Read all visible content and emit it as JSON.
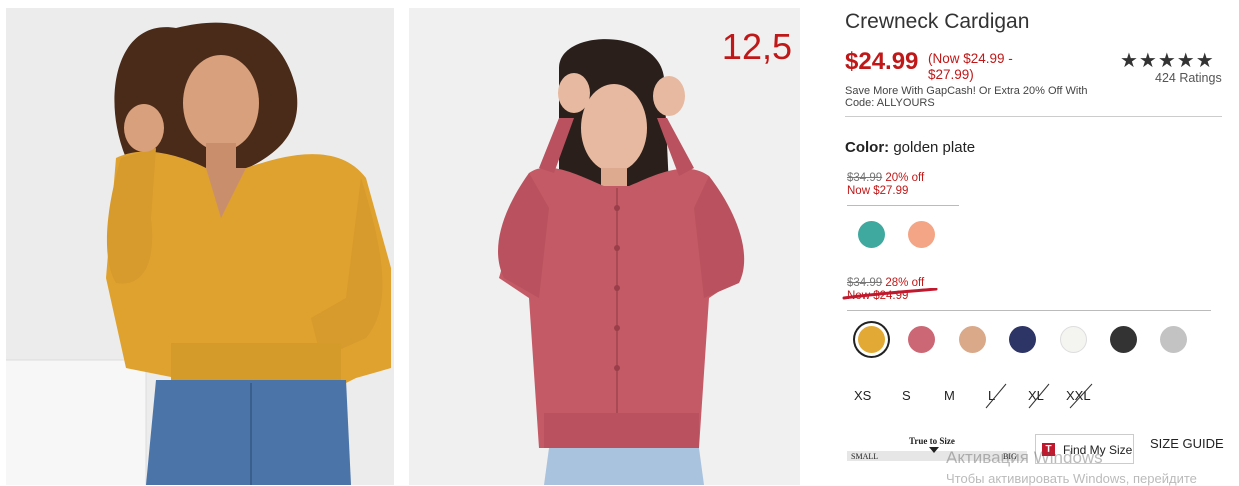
{
  "product": {
    "title": "Crewneck Cardigan",
    "price": "$24.99",
    "price_range": "(Now $24.99 - $27.99)",
    "rating_stars": "★★★★★",
    "rating_value": 4.5,
    "ratings_count": "424 Ratings",
    "promo": "Save More With GapCash! Or Extra 20% Off With Code: ALLYOURS"
  },
  "images": {
    "overlay_price": "12,5"
  },
  "color": {
    "label": "Color:",
    "value": "golden plate"
  },
  "tiers": [
    {
      "was": "$34.99",
      "off": "20% off",
      "now": "Now $27.99"
    },
    {
      "was": "$34.99",
      "off": "28% off",
      "now": "Now $24.99"
    }
  ],
  "swatches_tier1": [
    {
      "name": "teal",
      "color": "#3fa9a0"
    },
    {
      "name": "peach",
      "color": "#f4a585"
    }
  ],
  "swatches_tier2": [
    {
      "name": "golden plate",
      "color": "#e2a934",
      "selected": true
    },
    {
      "name": "rose",
      "color": "#cc6875"
    },
    {
      "name": "tan",
      "color": "#d9a98a"
    },
    {
      "name": "navy",
      "color": "#2d3466"
    },
    {
      "name": "white",
      "color": "#f4f4f0"
    },
    {
      "name": "black",
      "color": "#333333"
    },
    {
      "name": "grey",
      "color": "#c3c3c3"
    }
  ],
  "sizes": [
    {
      "label": "XS",
      "available": true
    },
    {
      "label": "S",
      "available": true
    },
    {
      "label": "M",
      "available": true
    },
    {
      "label": "L",
      "available": false
    },
    {
      "label": "XL",
      "available": false
    },
    {
      "label": "XXL",
      "available": false
    }
  ],
  "fit": {
    "label": "True to Size",
    "small": "SMALL",
    "big": "BIG"
  },
  "actions": {
    "find_my_size": "Find My Size",
    "size_guide": "SIZE GUIDE"
  },
  "watermark": {
    "line1": "Активация Windows",
    "line2": "Чтобы активировать Windows, перейдите"
  }
}
